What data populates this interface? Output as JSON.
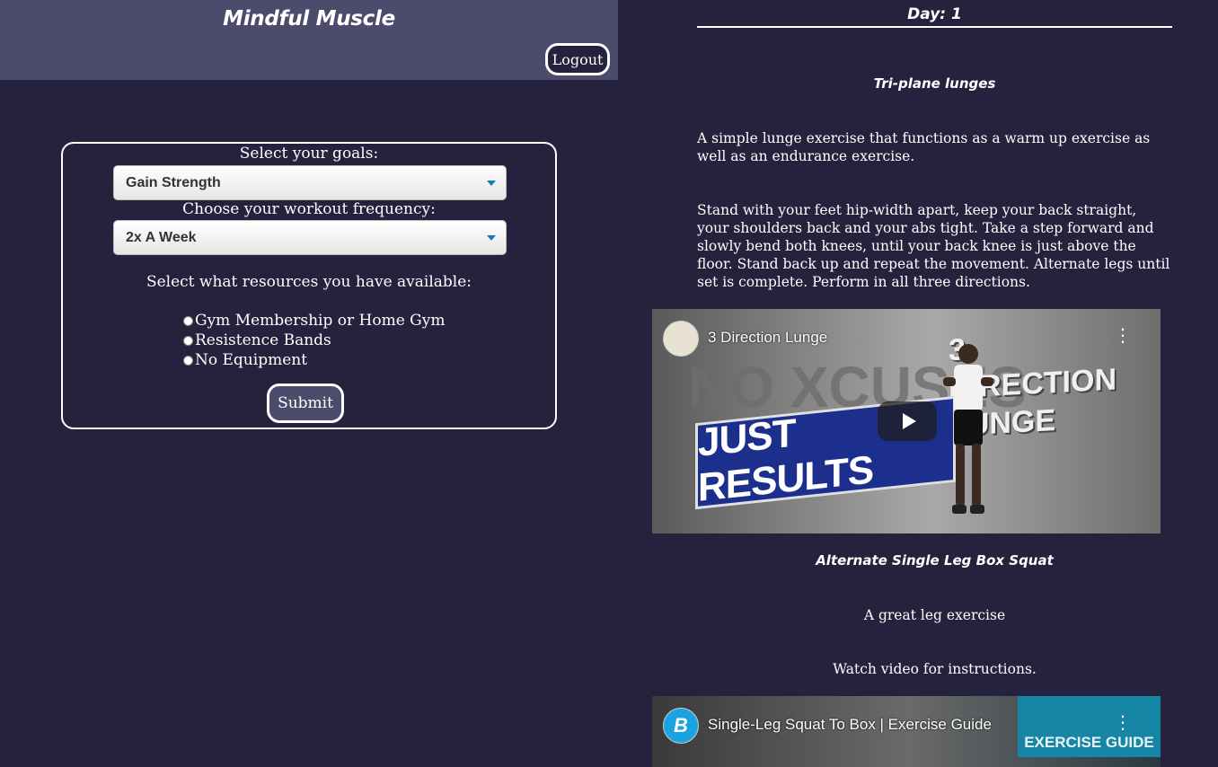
{
  "header": {
    "title": "Mindful Muscle",
    "logout_label": "Logout"
  },
  "form": {
    "goals_label": "Select your goals:",
    "goals_value": "Gain Strength",
    "frequency_label": "Choose your workout frequency:",
    "frequency_value": "2x A Week",
    "resources_label": "Select what resources you have available:",
    "resources": [
      "Gym Membership or Home Gym",
      "Resistence Bands",
      "No Equipment"
    ],
    "submit_label": "Submit"
  },
  "plan": {
    "day": "Day: 1",
    "exercises": [
      {
        "name": "Tri-plane lunges",
        "summary": "A simple lunge exercise that functions as a warm up exercise as well as an endurance exercise.",
        "instructions": "Stand with your feet hip-width apart, keep your back straight, your shoulders back and your abs tight. Take a step forward and slowly bend both knees, until your back knee is just above the floor. Stand back up and repeat the movement. Alternate legs until set is complete. Perform in all three directions.",
        "video_title": "3 Direction Lunge",
        "video_banner": "JUST RESULTS",
        "video_wall_text": "NO XCUSES",
        "video_overlay": "3 DIRECTION LUNGE"
      },
      {
        "name": "Alternate Single Leg Box Squat",
        "summary": "A great leg exercise",
        "instructions": "Watch video for instructions.",
        "video_title": "Single-Leg Squat To Box | Exercise Guide",
        "video_badge": "EXERCISE GUIDE",
        "channel_letter": "B"
      }
    ]
  },
  "colors": {
    "background": "#24223c",
    "header": "#4c4b6b",
    "accent_blue": "#1b7bb5"
  }
}
